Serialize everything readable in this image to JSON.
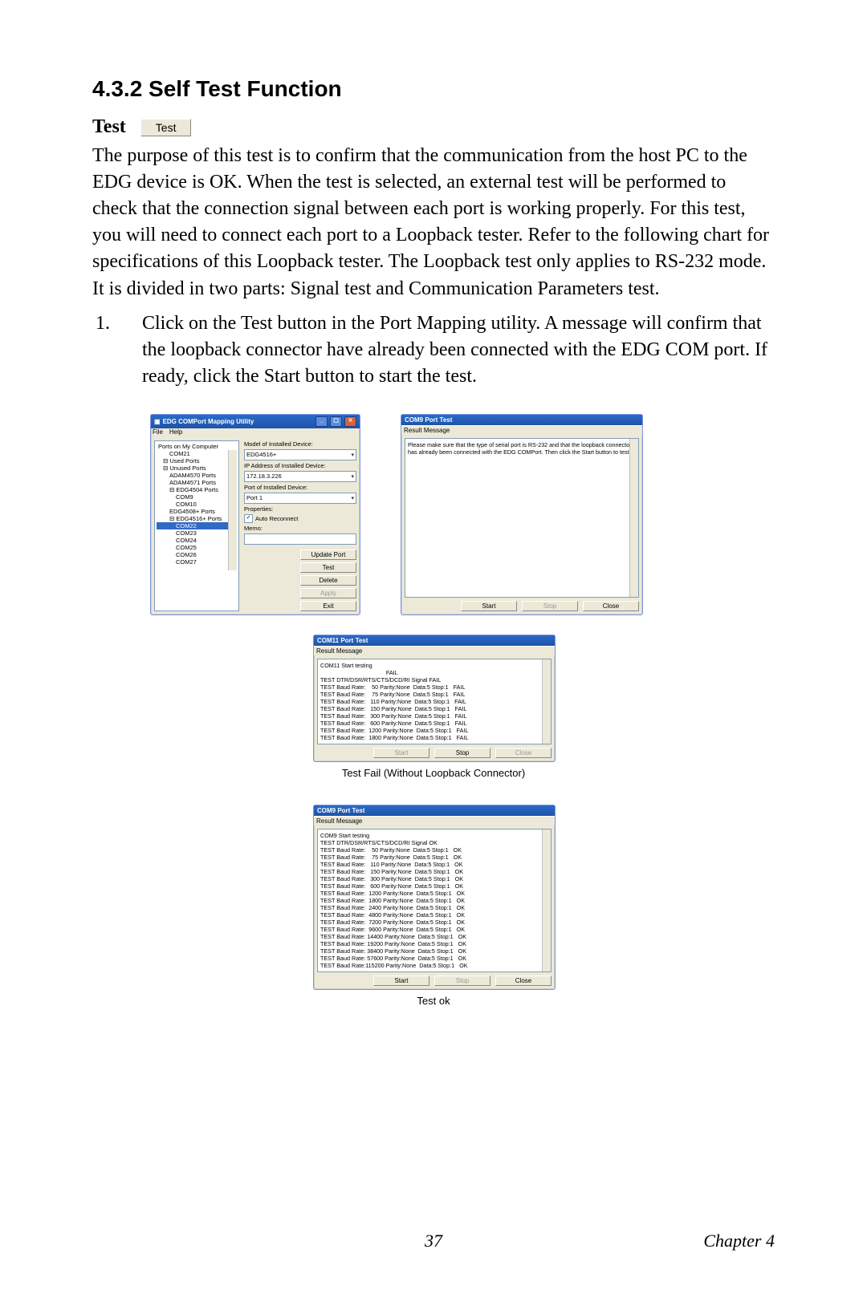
{
  "heading": "4.3.2 Self Test Function",
  "test_label": "Test",
  "test_button": "Test",
  "paragraph": "The purpose of this test is to confirm that the communication from the host PC to the EDG device is OK. When the test is selected, an external test will be performed to check that the connection signal between each port is working properly. For this test, you will need to connect each port to a Loopback tester. Refer to the following chart for specifications of this Loopback tester. The Loopback test only applies to RS-232 mode. It is divided in two parts: Signal test and Communication Parameters test.",
  "step_num": "1.",
  "step_text": "Click on the Test button in the Port Mapping utility. A message will confirm that the loopback connector have already been connected with the EDG COM port. If ready, click the Start button to start the test.",
  "map_window": {
    "title": "EDG COMPort Mapping Utility",
    "menu": [
      "File",
      "Help"
    ],
    "tree_header": "Ports on My Computer",
    "tree": [
      {
        "txt": "COM21",
        "cls": "lv2"
      },
      {
        "txt": "⊟ Used Ports",
        "cls": "lv1"
      },
      {
        "txt": "⊟ Unused Ports",
        "cls": "lv1"
      },
      {
        "txt": "ADAM4570 Ports",
        "cls": "lv2"
      },
      {
        "txt": "ADAM4571 Ports",
        "cls": "lv2"
      },
      {
        "txt": "⊟ EDG4504 Ports",
        "cls": "lv2"
      },
      {
        "txt": "COM9",
        "cls": "lv3"
      },
      {
        "txt": "COM10",
        "cls": "lv3"
      },
      {
        "txt": "EDG4508+ Ports",
        "cls": "lv2"
      },
      {
        "txt": "⊟ EDG4516+ Ports",
        "cls": "lv2"
      },
      {
        "txt": "COM22",
        "cls": "lv3 sel"
      },
      {
        "txt": "COM23",
        "cls": "lv3"
      },
      {
        "txt": "COM24",
        "cls": "lv3"
      },
      {
        "txt": "COM25",
        "cls": "lv3"
      },
      {
        "txt": "COM26",
        "cls": "lv3"
      },
      {
        "txt": "COM27",
        "cls": "lv3"
      }
    ],
    "model_label": "Model of Installed Device:",
    "model_value": "EDG4516+",
    "ip_label": "IP Address of Installed Device:",
    "ip_value": "172.18.3.226",
    "port_label": "Port of Installed Device:",
    "port_value": "Port 1",
    "properties_label": "Properties:",
    "auto_reconnect": "Auto Reconnect",
    "memo_label": "Memo:",
    "buttons": {
      "update": "Update Port",
      "test": "Test",
      "delete": "Delete",
      "apply": "Apply",
      "exit": "Exit"
    }
  },
  "port_test_prompt": {
    "title": "COM9 Port Test",
    "section": "Result Message",
    "message": "Please make sure that the type of serial port is RS-232 and that the loopback connector has already been connected with the EDG COMPort. Then click the Start button to test.",
    "start": "Start",
    "stop": "Stop",
    "close": "Close"
  },
  "port_test_fail": {
    "title": "COM11 Port Test",
    "section": "Result Message",
    "lines": [
      "COM11 Start testing",
      "                                         FAIL",
      "TEST DTR/DSR/RTS/CTS/DCD/RI Signal FAIL",
      "TEST Baud Rate:    50 Parity:None  Data:5 Stop:1   FAIL",
      "TEST Baud Rate:    75 Parity:None  Data:5 Stop:1   FAIL",
      "TEST Baud Rate:   110 Parity:None  Data:5 Stop:1   FAIL",
      "TEST Baud Rate:   150 Parity:None  Data:5 Stop:1   FAIL",
      "TEST Baud Rate:   300 Parity:None  Data:5 Stop:1   FAIL",
      "TEST Baud Rate:   600 Parity:None  Data:5 Stop:1   FAIL",
      "TEST Baud Rate:  1200 Parity:None  Data:5 Stop:1   FAIL",
      "TEST Baud Rate:  1800 Parity:None  Data:5 Stop:1   FAIL"
    ],
    "start": "Start",
    "stop": "Stop",
    "close": "Close",
    "caption": "Test Fail (Without Loopback Connector)"
  },
  "port_test_ok": {
    "title": "COM9 Port Test",
    "section": "Result Message",
    "lines": [
      "COM9 Start testing",
      "TEST DTR/DSR/RTS/CTS/DCD/RI Signal OK",
      "TEST Baud Rate:    50 Parity:None  Data:5 Stop:1   OK",
      "TEST Baud Rate:    75 Parity:None  Data:5 Stop:1   OK",
      "TEST Baud Rate:   110 Parity:None  Data:5 Stop:1   OK",
      "TEST Baud Rate:   150 Parity:None  Data:5 Stop:1   OK",
      "TEST Baud Rate:   300 Parity:None  Data:5 Stop:1   OK",
      "TEST Baud Rate:   600 Parity:None  Data:5 Stop:1   OK",
      "TEST Baud Rate:  1200 Parity:None  Data:5 Stop:1   OK",
      "TEST Baud Rate:  1800 Parity:None  Data:5 Stop:1   OK",
      "TEST Baud Rate:  2400 Parity:None  Data:5 Stop:1   OK",
      "TEST Baud Rate:  4800 Parity:None  Data:5 Stop:1   OK",
      "TEST Baud Rate:  7200 Parity:None  Data:5 Stop:1   OK",
      "TEST Baud Rate:  9600 Parity:None  Data:5 Stop:1   OK",
      "TEST Baud Rate: 14400 Parity:None  Data:5 Stop:1   OK",
      "TEST Baud Rate: 19200 Parity:None  Data:5 Stop:1   OK",
      "TEST Baud Rate: 38400 Parity:None  Data:5 Stop:1   OK",
      "TEST Baud Rate: 57600 Parity:None  Data:5 Stop:1   OK",
      "TEST Baud Rate:115200 Parity:None  Data:5 Stop:1   OK"
    ],
    "start": "Start",
    "stop": "Stop",
    "close": "Close",
    "caption": "Test ok"
  },
  "footer": {
    "page": "37",
    "chapter": "Chapter 4"
  }
}
